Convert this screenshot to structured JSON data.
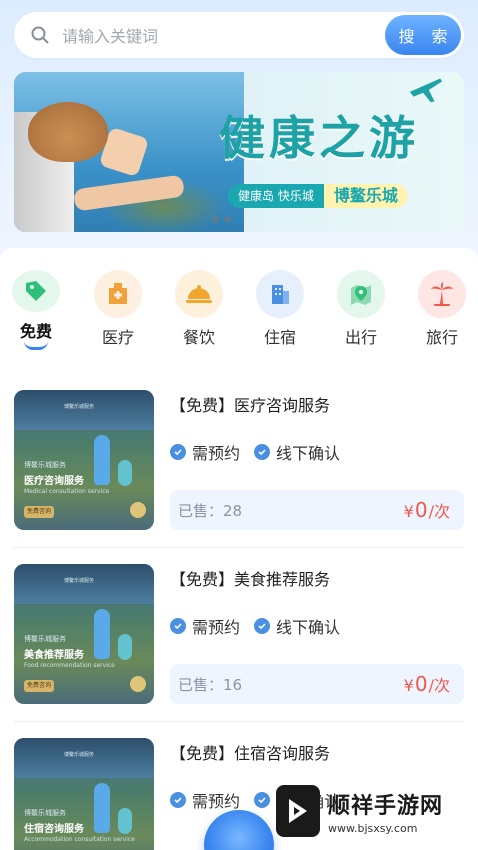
{
  "search": {
    "placeholder": "请输入关键词",
    "button_label": "搜 索"
  },
  "banner": {
    "title": "健康之游",
    "tag_left": "健康岛 快乐城",
    "tag_right": "博鳌乐城"
  },
  "categories": [
    {
      "label": "免费",
      "icon": "tag-icon",
      "color": "#2fbf7a",
      "active": true
    },
    {
      "label": "医疗",
      "icon": "hospital-icon",
      "color": "#f2a03a",
      "active": false
    },
    {
      "label": "餐饮",
      "icon": "food-cloche-icon",
      "color": "#f0a62c",
      "active": false
    },
    {
      "label": "住宿",
      "icon": "building-icon",
      "color": "#4a90e2",
      "active": false
    },
    {
      "label": "出行",
      "icon": "map-pin-icon",
      "color": "#2fbf7a",
      "active": false
    },
    {
      "label": "旅行",
      "icon": "palm-tree-icon",
      "color": "#f05a4a",
      "active": false
    }
  ],
  "services": [
    {
      "name": "【免费】医疗咨询服务",
      "tags": [
        "需预约",
        "线下确认"
      ],
      "sold": "已售：28",
      "price_prefix": "¥",
      "price_value": "0",
      "price_unit": "/次",
      "thumb_heading": "博鳌乐城服务",
      "thumb_title": "医疗咨询服务",
      "thumb_en": "Medical consultation service",
      "thumb_chip": "免费咨询"
    },
    {
      "name": "【免费】美食推荐服务",
      "tags": [
        "需预约",
        "线下确认"
      ],
      "sold": "已售：16",
      "price_prefix": "¥",
      "price_value": "0",
      "price_unit": "/次",
      "thumb_heading": "博鳌乐城服务",
      "thumb_title": "美食推荐服务",
      "thumb_en": "Food recommendation service",
      "thumb_chip": "免费咨询"
    },
    {
      "name": "【免费】住宿咨询服务",
      "tags": [
        "需预约",
        "线下确认"
      ],
      "sold": "",
      "price_prefix": "",
      "price_value": "",
      "price_unit": "",
      "thumb_heading": "博鳌乐城服务",
      "thumb_title": "住宿咨询服务",
      "thumb_en": "Accommodation consultation service",
      "thumb_chip": ""
    }
  ],
  "watermark": {
    "brand": "顺祥手游网",
    "url": "www.bjsxsy.com"
  }
}
